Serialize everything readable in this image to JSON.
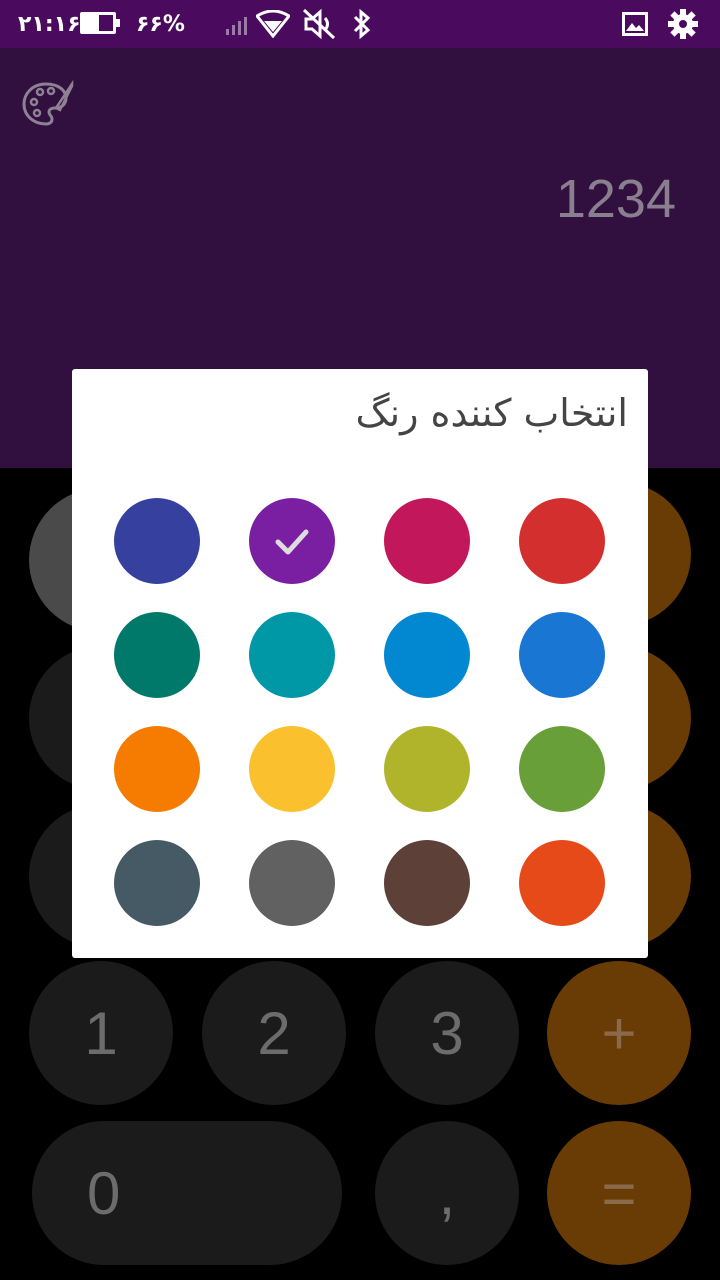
{
  "status_bar": {
    "time": "۲۱:۱۶",
    "battery_percent": "۶۶%",
    "battery_level": 0.66,
    "icons": [
      "battery-icon",
      "signal-icon",
      "wifi-icon",
      "mute-icon",
      "bluetooth-icon",
      "gallery-icon",
      "gear-icon"
    ]
  },
  "display": {
    "value": "1234",
    "palette_icon": "palette-icon"
  },
  "dialog": {
    "title": "انتخاب کننده رنگ",
    "selected_index": 1,
    "colors": [
      "#35409f",
      "#7b1fa2",
      "#c2185b",
      "#d32f2f",
      "#00796b",
      "#0097a7",
      "#0288d1",
      "#1976d2",
      "#f57c00",
      "#fbc02d",
      "#afb42b",
      "#689f38",
      "#455a64",
      "#616161",
      "#5d4037",
      "#e64a19"
    ]
  },
  "keypad": {
    "keys": [
      {
        "label": "1"
      },
      {
        "label": "2"
      },
      {
        "label": "3"
      },
      {
        "label": "+"
      },
      {
        "label": "0"
      },
      {
        "label": ","
      },
      {
        "label": "="
      }
    ]
  },
  "theme": {
    "status_bar_bg": "#4a0a5e",
    "display_bg": "#31103f",
    "operator_key": "#6a3c05",
    "number_key": "#1b1b1b"
  }
}
